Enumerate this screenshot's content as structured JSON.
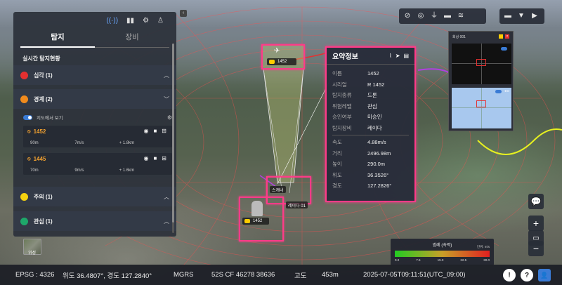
{
  "toolbar": {
    "left_icons": [
      "no-entry-icon",
      "compass-icon",
      "antenna-icon",
      "camera-icon",
      "radar-jammer-icon"
    ],
    "right_icons": [
      "ruler-icon",
      "filter-icon",
      "play-icon"
    ]
  },
  "panel": {
    "top_icons": [
      "signal-icon",
      "bar-chart-icon",
      "gear-icon",
      "user-icon"
    ],
    "tabs": [
      {
        "label": "탐지",
        "active": true
      },
      {
        "label": "장비",
        "active": false
      }
    ],
    "section_title": "실시간 탐지현황",
    "categories": [
      {
        "label": "심각 (1)",
        "color": "#e53030",
        "chevron": "⌃"
      },
      {
        "label": "경계 (2)",
        "color": "#f08a1c",
        "chevron": "⌄"
      },
      {
        "label": "주의 (1)",
        "color": "#f5d20f",
        "chevron": "⌃"
      },
      {
        "label": "관심 (1)",
        "color": "#1ea86a",
        "chevron": "⌃"
      }
    ],
    "map_toggle_label": "지도에서 보기",
    "detections": [
      {
        "id": "1452",
        "altitude": "90m",
        "speed": "7m/s",
        "distance": "+ 1.8km"
      },
      {
        "id": "1445",
        "altitude": "70m",
        "speed": "9m/s",
        "distance": "+ 1.6km"
      }
    ]
  },
  "satellite_label": "위성",
  "target_tag": "1452",
  "target_tag2": "1452",
  "small_label_a": "스캐너",
  "small_label_b": "레이다 01",
  "info": {
    "title": "요약정보",
    "rows": [
      {
        "k": "이름",
        "v": "1452"
      },
      {
        "k": "시리얼",
        "v": "R 1452"
      },
      {
        "k": "탐지종류",
        "v": "드론"
      },
      {
        "k": "위험레벨",
        "v": "관심"
      },
      {
        "k": "승인여부",
        "v": "미승인"
      },
      {
        "k": "탐지장비",
        "v": "레이다"
      }
    ],
    "rows2": [
      {
        "k": "속도",
        "v": "4.88m/s"
      },
      {
        "k": "거리",
        "v": "2496.98m"
      },
      {
        "k": "높이",
        "v": "290.0m"
      },
      {
        "k": "위도",
        "v": "36.3526°"
      },
      {
        "k": "경도",
        "v": "127.2826°"
      }
    ]
  },
  "video": {
    "title": "회상 001",
    "close": "×",
    "lower_label": "EO"
  },
  "legend": {
    "title": "범례 (속력)",
    "unit": "단위: m/s",
    "ticks": [
      "0.0",
      "7.5",
      "15.0",
      "22.5",
      "30.0"
    ]
  },
  "status": {
    "epsg": "EPSG : 4326",
    "latlon": "위도 36.4807°, 경도 127.2840°",
    "mgrs_label": "MGRS",
    "mgrs": "52S CF 46278 38636",
    "alt_label": "고도",
    "alt": "453m",
    "time": "2025-07-05T09:11:51(UTC_09:00)"
  },
  "buttons": {
    "alert": "!",
    "help": "?",
    "user": "👤"
  }
}
